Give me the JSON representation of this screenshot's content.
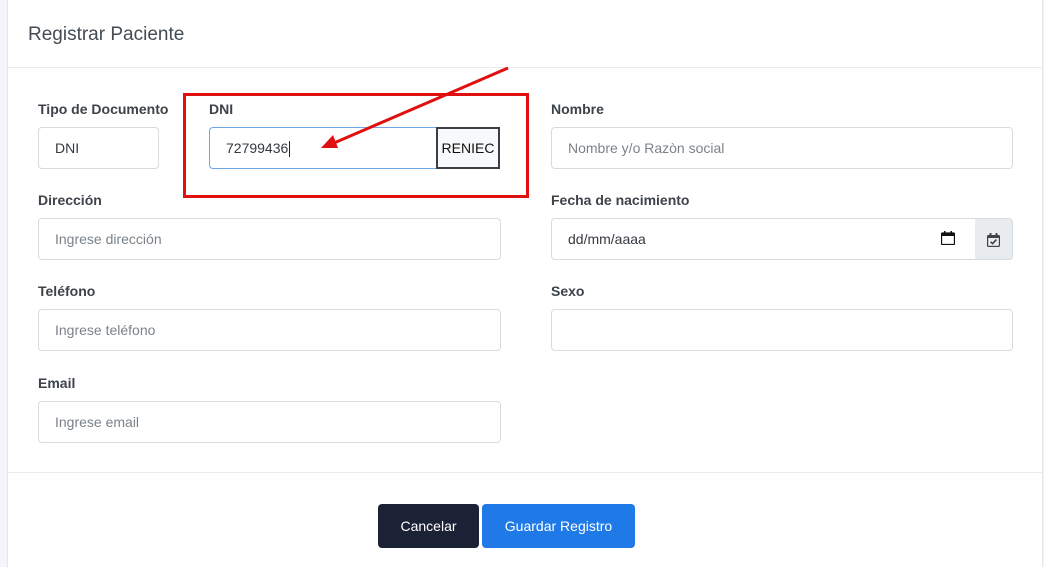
{
  "modal": {
    "title": "Registrar Paciente"
  },
  "form": {
    "tipo_documento": {
      "label": "Tipo de Documento",
      "value": "DNI"
    },
    "dni": {
      "label": "DNI",
      "value": "72799436",
      "button": "RENIEC"
    },
    "nombre": {
      "label": "Nombre",
      "placeholder": "Nombre y/o Razòn social"
    },
    "direccion": {
      "label": "Dirección",
      "placeholder": "Ingrese dirección"
    },
    "fecha_nacimiento": {
      "label": "Fecha de nacimiento",
      "placeholder": "dd/mm/aaaa"
    },
    "telefono": {
      "label": "Teléfono",
      "placeholder": "Ingrese teléfono"
    },
    "sexo": {
      "label": "Sexo",
      "value": ""
    },
    "email": {
      "label": "Email",
      "placeholder": "Ingrese email"
    }
  },
  "footer": {
    "cancel_label": "Cancelar",
    "save_label": "Guardar Registro"
  },
  "annotation": {
    "highlight_color": "#e01010"
  },
  "icons": {
    "date_picker": "calendar-icon",
    "calendar_check": "calendar-check-icon",
    "annotation_arrow": "arrow-icon"
  },
  "colors": {
    "primary": "#1f7ae8",
    "dark": "#1c2236"
  }
}
